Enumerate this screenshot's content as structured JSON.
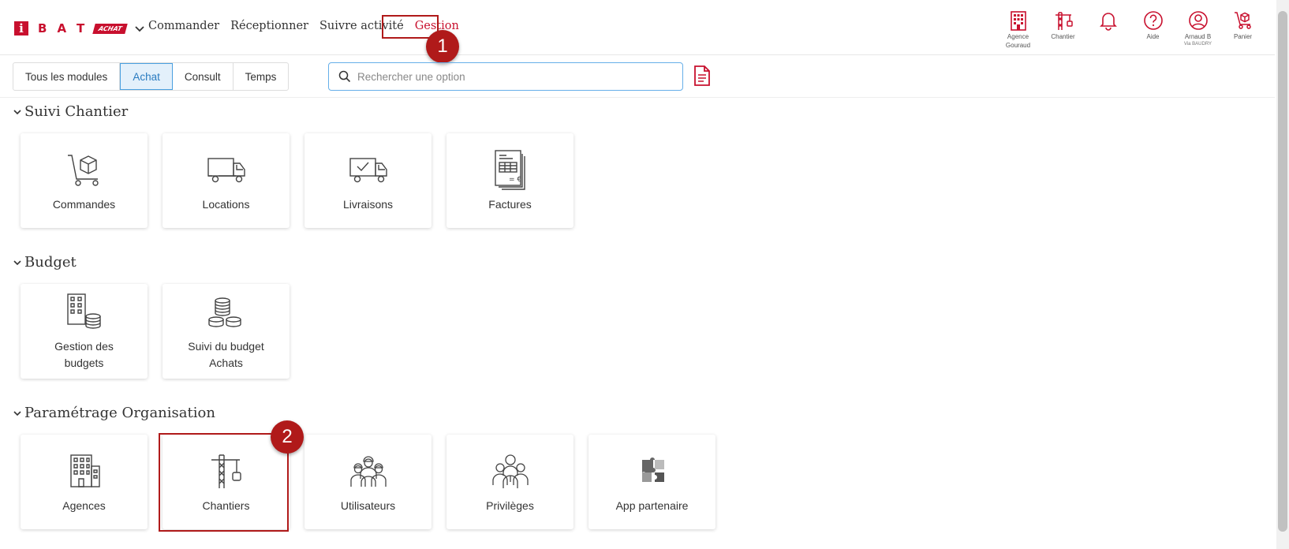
{
  "brand": {
    "letters": [
      "B",
      "A",
      "T"
    ],
    "i": "i",
    "badge": "ACHAT",
    "color": "#c8102e"
  },
  "nav": {
    "items": [
      {
        "label": "Commander"
      },
      {
        "label": "Réceptionner"
      },
      {
        "label": "Suivre activité"
      },
      {
        "label": "Gestion",
        "active": true
      }
    ]
  },
  "top_icons": [
    {
      "label": "Agence",
      "sub": "Gouraud",
      "icon": "building-icon"
    },
    {
      "label": "Chantier",
      "sub": "",
      "icon": "crane-icon"
    },
    {
      "label": "",
      "sub": "",
      "icon": "bell-icon"
    },
    {
      "label": "Aide",
      "sub": "",
      "icon": "help-icon"
    },
    {
      "label": "Arnaud B",
      "sub": "Via BAUDRY",
      "icon": "user-icon"
    },
    {
      "label": "Panier",
      "sub": "",
      "icon": "cart-icon"
    }
  ],
  "tabs": [
    {
      "label": "Tous les modules"
    },
    {
      "label": "Achat",
      "active": true
    },
    {
      "label": "Consult"
    },
    {
      "label": "Temps"
    }
  ],
  "search": {
    "placeholder": "Rechercher une option"
  },
  "sections": [
    {
      "title": "Suivi Chantier",
      "tiles": [
        {
          "label": "Commandes",
          "icon": "trolley-box-icon"
        },
        {
          "label": "Locations",
          "icon": "truck-icon"
        },
        {
          "label": "Livraisons",
          "icon": "delivery-truck-check-icon"
        },
        {
          "label": "Factures",
          "icon": "invoice-icon"
        }
      ]
    },
    {
      "title": "Budget",
      "tiles": [
        {
          "label": "Gestion des budgets",
          "icon": "building-coins-icon"
        },
        {
          "label": "Suivi du budget Achats",
          "icon": "coins-icon"
        }
      ]
    },
    {
      "title": "Paramétrage Organisation",
      "tiles": [
        {
          "label": "Agences",
          "icon": "office-building-icon"
        },
        {
          "label": "Chantiers",
          "icon": "crane-icon"
        },
        {
          "label": "Utilisateurs",
          "icon": "workers-icon"
        },
        {
          "label": "Privilèges",
          "icon": "people-group-icon"
        },
        {
          "label": "App partenaire",
          "icon": "puzzle-icon"
        }
      ]
    }
  ],
  "annotations": [
    {
      "number": "1"
    },
    {
      "number": "2"
    }
  ]
}
